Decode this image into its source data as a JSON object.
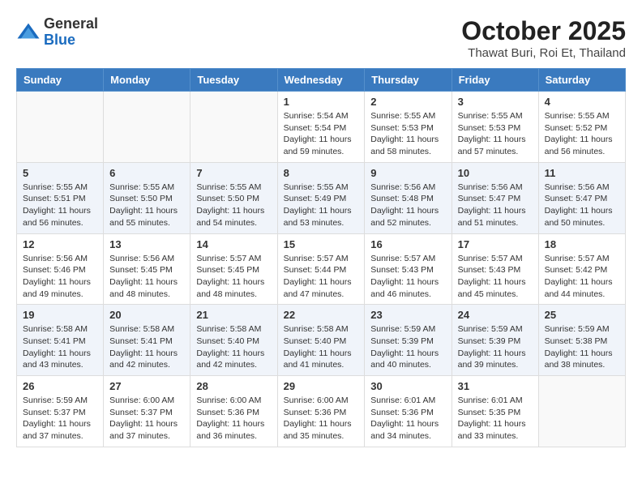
{
  "header": {
    "logo": {
      "line1": "General",
      "line2": "Blue"
    },
    "title": "October 2025",
    "location": "Thawat Buri, Roi Et, Thailand"
  },
  "days_of_week": [
    "Sunday",
    "Monday",
    "Tuesday",
    "Wednesday",
    "Thursday",
    "Friday",
    "Saturday"
  ],
  "weeks": [
    [
      {
        "day": "",
        "info": ""
      },
      {
        "day": "",
        "info": ""
      },
      {
        "day": "",
        "info": ""
      },
      {
        "day": "1",
        "info": "Sunrise: 5:54 AM\nSunset: 5:54 PM\nDaylight: 11 hours\nand 59 minutes."
      },
      {
        "day": "2",
        "info": "Sunrise: 5:55 AM\nSunset: 5:53 PM\nDaylight: 11 hours\nand 58 minutes."
      },
      {
        "day": "3",
        "info": "Sunrise: 5:55 AM\nSunset: 5:53 PM\nDaylight: 11 hours\nand 57 minutes."
      },
      {
        "day": "4",
        "info": "Sunrise: 5:55 AM\nSunset: 5:52 PM\nDaylight: 11 hours\nand 56 minutes."
      }
    ],
    [
      {
        "day": "5",
        "info": "Sunrise: 5:55 AM\nSunset: 5:51 PM\nDaylight: 11 hours\nand 56 minutes."
      },
      {
        "day": "6",
        "info": "Sunrise: 5:55 AM\nSunset: 5:50 PM\nDaylight: 11 hours\nand 55 minutes."
      },
      {
        "day": "7",
        "info": "Sunrise: 5:55 AM\nSunset: 5:50 PM\nDaylight: 11 hours\nand 54 minutes."
      },
      {
        "day": "8",
        "info": "Sunrise: 5:55 AM\nSunset: 5:49 PM\nDaylight: 11 hours\nand 53 minutes."
      },
      {
        "day": "9",
        "info": "Sunrise: 5:56 AM\nSunset: 5:48 PM\nDaylight: 11 hours\nand 52 minutes."
      },
      {
        "day": "10",
        "info": "Sunrise: 5:56 AM\nSunset: 5:47 PM\nDaylight: 11 hours\nand 51 minutes."
      },
      {
        "day": "11",
        "info": "Sunrise: 5:56 AM\nSunset: 5:47 PM\nDaylight: 11 hours\nand 50 minutes."
      }
    ],
    [
      {
        "day": "12",
        "info": "Sunrise: 5:56 AM\nSunset: 5:46 PM\nDaylight: 11 hours\nand 49 minutes."
      },
      {
        "day": "13",
        "info": "Sunrise: 5:56 AM\nSunset: 5:45 PM\nDaylight: 11 hours\nand 48 minutes."
      },
      {
        "day": "14",
        "info": "Sunrise: 5:57 AM\nSunset: 5:45 PM\nDaylight: 11 hours\nand 48 minutes."
      },
      {
        "day": "15",
        "info": "Sunrise: 5:57 AM\nSunset: 5:44 PM\nDaylight: 11 hours\nand 47 minutes."
      },
      {
        "day": "16",
        "info": "Sunrise: 5:57 AM\nSunset: 5:43 PM\nDaylight: 11 hours\nand 46 minutes."
      },
      {
        "day": "17",
        "info": "Sunrise: 5:57 AM\nSunset: 5:43 PM\nDaylight: 11 hours\nand 45 minutes."
      },
      {
        "day": "18",
        "info": "Sunrise: 5:57 AM\nSunset: 5:42 PM\nDaylight: 11 hours\nand 44 minutes."
      }
    ],
    [
      {
        "day": "19",
        "info": "Sunrise: 5:58 AM\nSunset: 5:41 PM\nDaylight: 11 hours\nand 43 minutes."
      },
      {
        "day": "20",
        "info": "Sunrise: 5:58 AM\nSunset: 5:41 PM\nDaylight: 11 hours\nand 42 minutes."
      },
      {
        "day": "21",
        "info": "Sunrise: 5:58 AM\nSunset: 5:40 PM\nDaylight: 11 hours\nand 42 minutes."
      },
      {
        "day": "22",
        "info": "Sunrise: 5:58 AM\nSunset: 5:40 PM\nDaylight: 11 hours\nand 41 minutes."
      },
      {
        "day": "23",
        "info": "Sunrise: 5:59 AM\nSunset: 5:39 PM\nDaylight: 11 hours\nand 40 minutes."
      },
      {
        "day": "24",
        "info": "Sunrise: 5:59 AM\nSunset: 5:39 PM\nDaylight: 11 hours\nand 39 minutes."
      },
      {
        "day": "25",
        "info": "Sunrise: 5:59 AM\nSunset: 5:38 PM\nDaylight: 11 hours\nand 38 minutes."
      }
    ],
    [
      {
        "day": "26",
        "info": "Sunrise: 5:59 AM\nSunset: 5:37 PM\nDaylight: 11 hours\nand 37 minutes."
      },
      {
        "day": "27",
        "info": "Sunrise: 6:00 AM\nSunset: 5:37 PM\nDaylight: 11 hours\nand 37 minutes."
      },
      {
        "day": "28",
        "info": "Sunrise: 6:00 AM\nSunset: 5:36 PM\nDaylight: 11 hours\nand 36 minutes."
      },
      {
        "day": "29",
        "info": "Sunrise: 6:00 AM\nSunset: 5:36 PM\nDaylight: 11 hours\nand 35 minutes."
      },
      {
        "day": "30",
        "info": "Sunrise: 6:01 AM\nSunset: 5:36 PM\nDaylight: 11 hours\nand 34 minutes."
      },
      {
        "day": "31",
        "info": "Sunrise: 6:01 AM\nSunset: 5:35 PM\nDaylight: 11 hours\nand 33 minutes."
      },
      {
        "day": "",
        "info": ""
      }
    ]
  ]
}
